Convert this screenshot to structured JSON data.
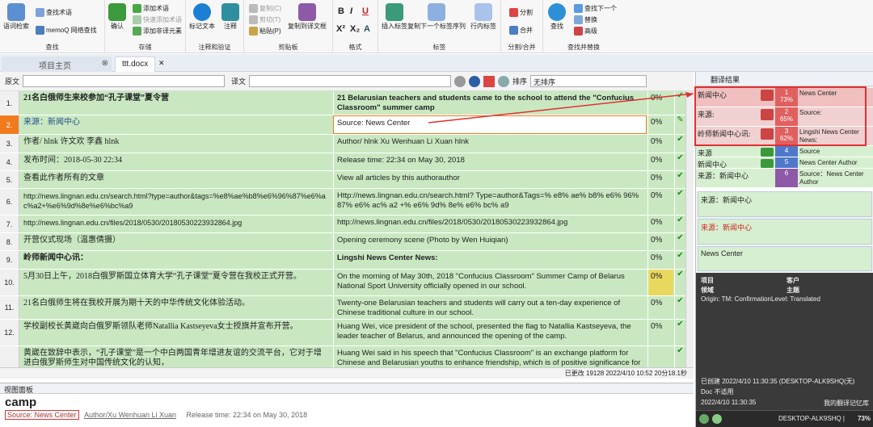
{
  "ribbon": {
    "groups": [
      {
        "label": "查找",
        "items": [
          "语词检索",
          "查找术语",
          "memoQ 网络查找"
        ]
      },
      {
        "label": "存储",
        "items": [
          "确认",
          "添加术语",
          "快速添加术语",
          "添加非译元素"
        ]
      },
      {
        "label": "注释和验证",
        "items": [
          "标记文本",
          "注释"
        ]
      },
      {
        "label": "剪贴板",
        "items": [
          "复制(C)",
          "剪切(T)",
          "粘贴(P)",
          "复制到译文框"
        ]
      },
      {
        "label": "格式",
        "items": [
          "B",
          "I",
          "U",
          "X²",
          "X₂",
          "A"
        ]
      },
      {
        "label": "标签",
        "items": [
          "插入标签",
          "复制下一个标签序列",
          "行内标签"
        ]
      },
      {
        "label": "分割/合并",
        "items": [
          "分割",
          "合并"
        ]
      },
      {
        "label": "查找并替换",
        "items": [
          "查找",
          "查找下一个",
          "替换",
          "高级"
        ]
      }
    ]
  },
  "tabs": {
    "home": "项目主页",
    "doc": "ttt.docx"
  },
  "filter": {
    "source_label": "原文",
    "target_label": "译文",
    "sort_label": "排序",
    "sort_value": "无排序"
  },
  "rows": [
    {
      "n": "1.",
      "src": "21名白俄师生来校参加“孔子课堂”夏令营",
      "tgt": "21 Belarusian teachers and students came to the school to attend the \"Confucius Classroom\" summer camp",
      "pct": "0%"
    },
    {
      "n": "2.",
      "src": "来源：新闻中心",
      "tgt": "Source: News Center",
      "pct": "0%"
    },
    {
      "n": "3.",
      "src": "作者/ hlnk 许文欢 李鑫 hlnk",
      "tgt": "Author/ hlnk Xu Wenhuan Li Xuan hlnk",
      "pct": "0%"
    },
    {
      "n": "4.",
      "src": "发布时间：2018-05-30 22:34",
      "tgt": "Release time: 22:34 on May 30, 2018",
      "pct": "0%"
    },
    {
      "n": "5.",
      "src": "查看此作者所有的文章",
      "tgt": "View all articles by this authorauthor",
      "pct": "0%"
    },
    {
      "n": "6.",
      "src": "http://news.lingnan.edu.cn/search.html?type=author&tags=%e8%ae%b8%e6%96%87%e6%ac%a2+%e6%9d%8e%e6%bc%a9",
      "tgt": "Http://news.lingnan.edu.cn/search.html? Type=author&Tags=% e8% ae% b8% e6% 96% 87% e6% ac% a2 +% e6% 9d% 8e% e6% bc% a9",
      "pct": "0%"
    },
    {
      "n": "7.",
      "src": "http://news.lingnan.edu.cn/files/2018/0530/20180530223932864.jpg",
      "tgt": "http://news.lingnan.edu.cn/files/2018/0530/20180530223932864.jpg",
      "pct": "0%"
    },
    {
      "n": "8.",
      "src": "开营仪式现场（温惠倩摄）",
      "tgt": "Opening ceremony scene (Photo by Wen Huiqian)",
      "pct": "0%"
    },
    {
      "n": "9.",
      "src": "岭师新闻中心讯：",
      "tgt": "Lingshi News Center News:",
      "pct": "0%"
    },
    {
      "n": "10.",
      "src": "5月30日上午，2018白俄罗斯国立体育大学“孔子课堂”夏令营在我校正式开营。",
      "tgt": "On the morning of May 30th, 2018 \"Confucius Classroom\" Summer Camp of Belarus National Sport University officially opened in our school.",
      "pct": "0%"
    },
    {
      "n": "11.",
      "src": "21名白俄师生将在我校开展为期十天的中华传统文化体验活动。",
      "tgt": "Twenty-one Belarusian teachers and students will carry out a ten-day experience of Chinese traditional culture in our school.",
      "pct": "0%"
    },
    {
      "n": "12.",
      "src": "学校副校长黄崴向白俄罗斯领队老师Natallia Kastseyeva女士授旗并宣布开营。",
      "tgt": "Huang Wei, vice president of the school, presented the flag to Natallia Kastseyeva, the leader teacher of Belarus, and announced the opening of the camp.",
      "pct": "0%"
    },
    {
      "n": "",
      "src": "黄崴在致辞中表示，“孔子课堂”是一个中白两国青年增进友谊的交流平台，它对于增进白俄罗斯师生对中国传统文化的认知，",
      "tgt": "Huang Wei said in his speech that \"Confucius Classroom\" is an exchange platform for Chinese and Belarusian youths to enhance friendship, which is of positive significance for",
      "pct": ""
    }
  ],
  "status": {
    "text": "已更改  19128 2022/4/10 10:52    20分18.1秒"
  },
  "view_panel": {
    "title": "视图面板",
    "word": "camp",
    "line_src": "Source: News Center",
    "line_author": "Author/Xu Wenhuan Li Xuan",
    "line_time": "Release time: 22:34 on May 30, 2018"
  },
  "right": {
    "title": "翻译结果",
    "matches": [
      {
        "l": "新闻中心",
        "n": "1",
        "p": "73%",
        "r": "News Center"
      },
      {
        "l": "来源:",
        "n": "2",
        "p": "65%",
        "r": "Source:"
      },
      {
        "l": "岭师新闻中心讯:",
        "n": "3",
        "p": "62%",
        "r": "Lingshi News Center News:"
      },
      {
        "l": "来源",
        "n": "4",
        "p": "",
        "r": "Source"
      },
      {
        "l": "新闻中心",
        "n": "5",
        "p": "",
        "r": "News Center Author"
      },
      {
        "l": "来源：新闻中心",
        "n": "6",
        "p": "",
        "r": "Source：News Center Author"
      }
    ],
    "box1": "来源：新闻中心",
    "box2": "来源：新闻中心",
    "box3": "News Center",
    "meta": {
      "project": "项目",
      "client": "客户",
      "domain": "领域",
      "subject": "主题",
      "origin": "Origin:  TM:  ConfirmationLevel:  Translated",
      "created": "已创建  2022/4/10 11:30:35 (DESKTOP-ALK9SHQ(无)",
      "doc": "Doc  不适用",
      "modified": "2022/4/10 11:30:35",
      "mine": "我的翻译记忆库",
      "machine": "DESKTOP-ALK9SHQ  |",
      "zoom": "73%"
    }
  },
  "colors": {
    "green": "#c9e8c1",
    "red_match": "#e06060",
    "blue_match": "#4f79c8",
    "purple_match": "#8e5aa8"
  }
}
